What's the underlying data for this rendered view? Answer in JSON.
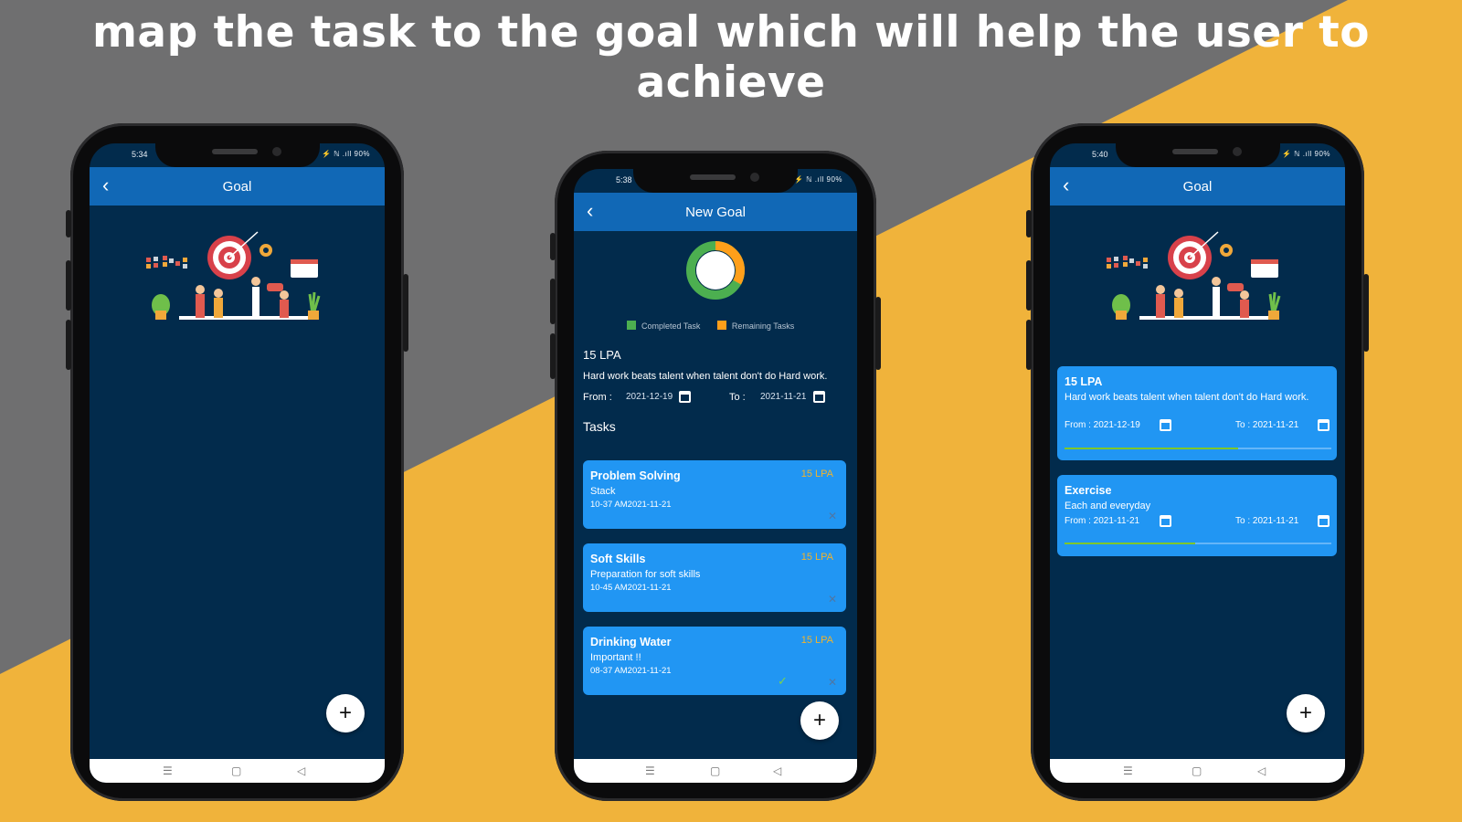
{
  "headline": "map the task to the goal which will help the user to achieve",
  "colors": {
    "gray": "#6f6f70",
    "amber": "#f0b33b",
    "navy": "#022b4c",
    "appbar": "#1168b6",
    "card": "#2196f3",
    "completed": "#4caf50",
    "remaining": "#ff9f1a"
  },
  "phone1": {
    "status_time": "5:34",
    "status_icons": "⚡ ℕ .ıll 90%",
    "title": "Goal",
    "back_icon": "chevron-left-icon",
    "fab": "+"
  },
  "phone2": {
    "status_time": "5:38",
    "status_icons": "⚡ ℕ .ıll 90%",
    "title": "New Goal",
    "progress": {
      "completed_fraction": 0.67,
      "remaining_fraction": 0.33
    },
    "legend": {
      "completed": "Completed Task",
      "remaining": "Remaining Tasks"
    },
    "goal_name": "15 LPA",
    "goal_desc": "Hard work beats talent when talent don't do Hard work.",
    "from_label": "From :",
    "from_date": "2021-12-19",
    "to_label": "To :",
    "to_date": "2021-11-21",
    "tasks_heading": "Tasks",
    "tasks": [
      {
        "title": "Problem Solving",
        "desc": "Stack",
        "meta": "10-37 AM2021-11-21",
        "tag": "15 LPA",
        "done": false
      },
      {
        "title": "Soft Skills",
        "desc": "Preparation for soft skills",
        "meta": "10-45 AM2021-11-21",
        "tag": "15 LPA",
        "done": false
      },
      {
        "title": "Drinking Water",
        "desc": "Important !!",
        "meta": "08-37 AM2021-11-21",
        "tag": "15 LPA",
        "done": true
      }
    ],
    "fab": "+"
  },
  "phone3": {
    "status_time": "5:40",
    "status_icons": "⚡ ℕ .ıll 90%",
    "title": "Goal",
    "goals": [
      {
        "title": "15 LPA",
        "desc": "Hard work beats talent when talent don't do Hard work.",
        "from": "From : 2021-12-19",
        "to": "To : 2021-11-21",
        "progress": 0.65
      },
      {
        "title": "Exercise",
        "desc": "Each and everyday",
        "from": "From : 2021-11-21",
        "to": "To : 2021-11-21",
        "progress": 0.49
      }
    ],
    "fab": "+"
  },
  "navbar": {
    "recent": "☰",
    "home": "▢",
    "back": "◁"
  }
}
